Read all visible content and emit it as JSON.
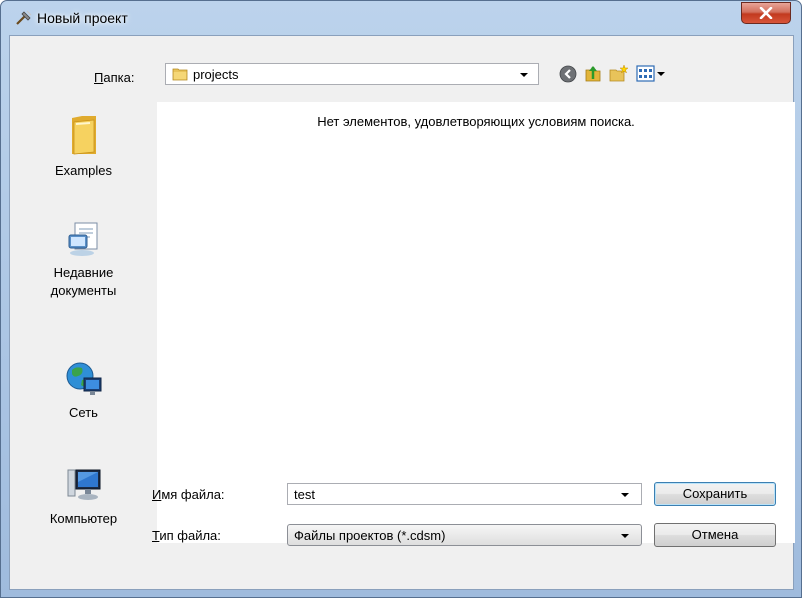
{
  "window": {
    "title": "Новый проект",
    "close_symbol": "x"
  },
  "toolbar": {
    "folder_label_mnemonic": "П",
    "folder_label_rest": "апка:",
    "folder_value": "projects"
  },
  "places": [
    {
      "label": "Examples",
      "icon": "folder-icon"
    },
    {
      "label_line1": "Недавние",
      "label_line2": "документы",
      "icon": "recent-documents-icon"
    },
    {
      "label": "Сеть",
      "icon": "network-icon"
    },
    {
      "label": "Компьютер",
      "icon": "computer-icon"
    }
  ],
  "file_list": {
    "empty_message": "Нет элементов, удовлетворяющих условиям поиска."
  },
  "form": {
    "filename_label_mnemonic": "И",
    "filename_label_rest": "мя файла:",
    "filename_value": "test",
    "filetype_label_mnemonic": "Т",
    "filetype_label_rest": "ип файла:",
    "filetype_value": "Файлы проектов (*.cdsm)"
  },
  "buttons": {
    "save": "Сохранить",
    "cancel": "Отмена"
  }
}
